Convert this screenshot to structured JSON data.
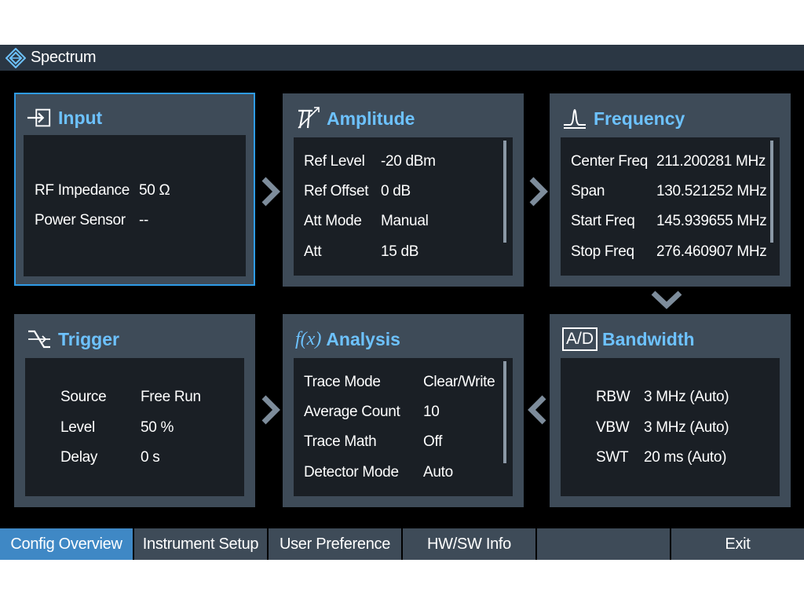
{
  "app": {
    "title": "Spectrum"
  },
  "panels": {
    "input": {
      "title": "Input",
      "rows": [
        {
          "label": "RF Impedance",
          "value": "50 Ω"
        },
        {
          "label": "Power Sensor",
          "value": "--"
        }
      ]
    },
    "amplitude": {
      "title": "Amplitude",
      "rows": [
        {
          "label": "Ref Level",
          "value": "-20 dBm"
        },
        {
          "label": "Ref Offset",
          "value": "0 dB"
        },
        {
          "label": "Att Mode",
          "value": "Manual"
        },
        {
          "label": "Att",
          "value": "15 dB"
        }
      ]
    },
    "frequency": {
      "title": "Frequency",
      "rows": [
        {
          "label": "Center Freq",
          "value": "211.200281 MHz"
        },
        {
          "label": "Span",
          "value": "130.521252 MHz"
        },
        {
          "label": "Start Freq",
          "value": "145.939655 MHz"
        },
        {
          "label": "Stop Freq",
          "value": "276.460907 MHz"
        }
      ]
    },
    "trigger": {
      "title": "Trigger",
      "rows": [
        {
          "label": "Source",
          "value": "Free Run"
        },
        {
          "label": "Level",
          "value": "50 %"
        },
        {
          "label": "Delay",
          "value": "0 s"
        }
      ]
    },
    "analysis": {
      "title": "Analysis",
      "icon_text": "f(x)",
      "rows": [
        {
          "label": "Trace Mode",
          "value": "Clear/Write"
        },
        {
          "label": "Average Count",
          "value": "10"
        },
        {
          "label": "Trace Math",
          "value": "Off"
        },
        {
          "label": "Detector Mode",
          "value": "Auto"
        }
      ]
    },
    "bandwidth": {
      "title": "Bandwidth",
      "icon_text": "A/D",
      "rows": [
        {
          "label": "RBW",
          "value": "3 MHz (Auto)"
        },
        {
          "label": "VBW",
          "value": "3 MHz (Auto)"
        },
        {
          "label": "SWT",
          "value": "20 ms (Auto)"
        }
      ]
    }
  },
  "softkeys": [
    {
      "label": "Config Overview",
      "active": true
    },
    {
      "label": "Instrument Setup",
      "active": false
    },
    {
      "label": "User Preference",
      "active": false
    },
    {
      "label": "HW/SW Info",
      "active": false
    },
    {
      "label": "",
      "active": false
    },
    {
      "label": "Exit",
      "active": false
    }
  ],
  "colors": {
    "accent": "#6dc2ff",
    "selected_border": "#2f9be6",
    "panel": "#3e4b58",
    "panel_body": "#1a1f25",
    "active_softkey": "#3f88c5"
  },
  "icons": {
    "logo": "rohde-schwarz-logo",
    "input": "input-arrow-icon",
    "amplitude": "amplitude-icon",
    "frequency": "frequency-peak-icon",
    "trigger": "trigger-icon",
    "analysis": "function-icon",
    "bandwidth": "ad-icon"
  }
}
